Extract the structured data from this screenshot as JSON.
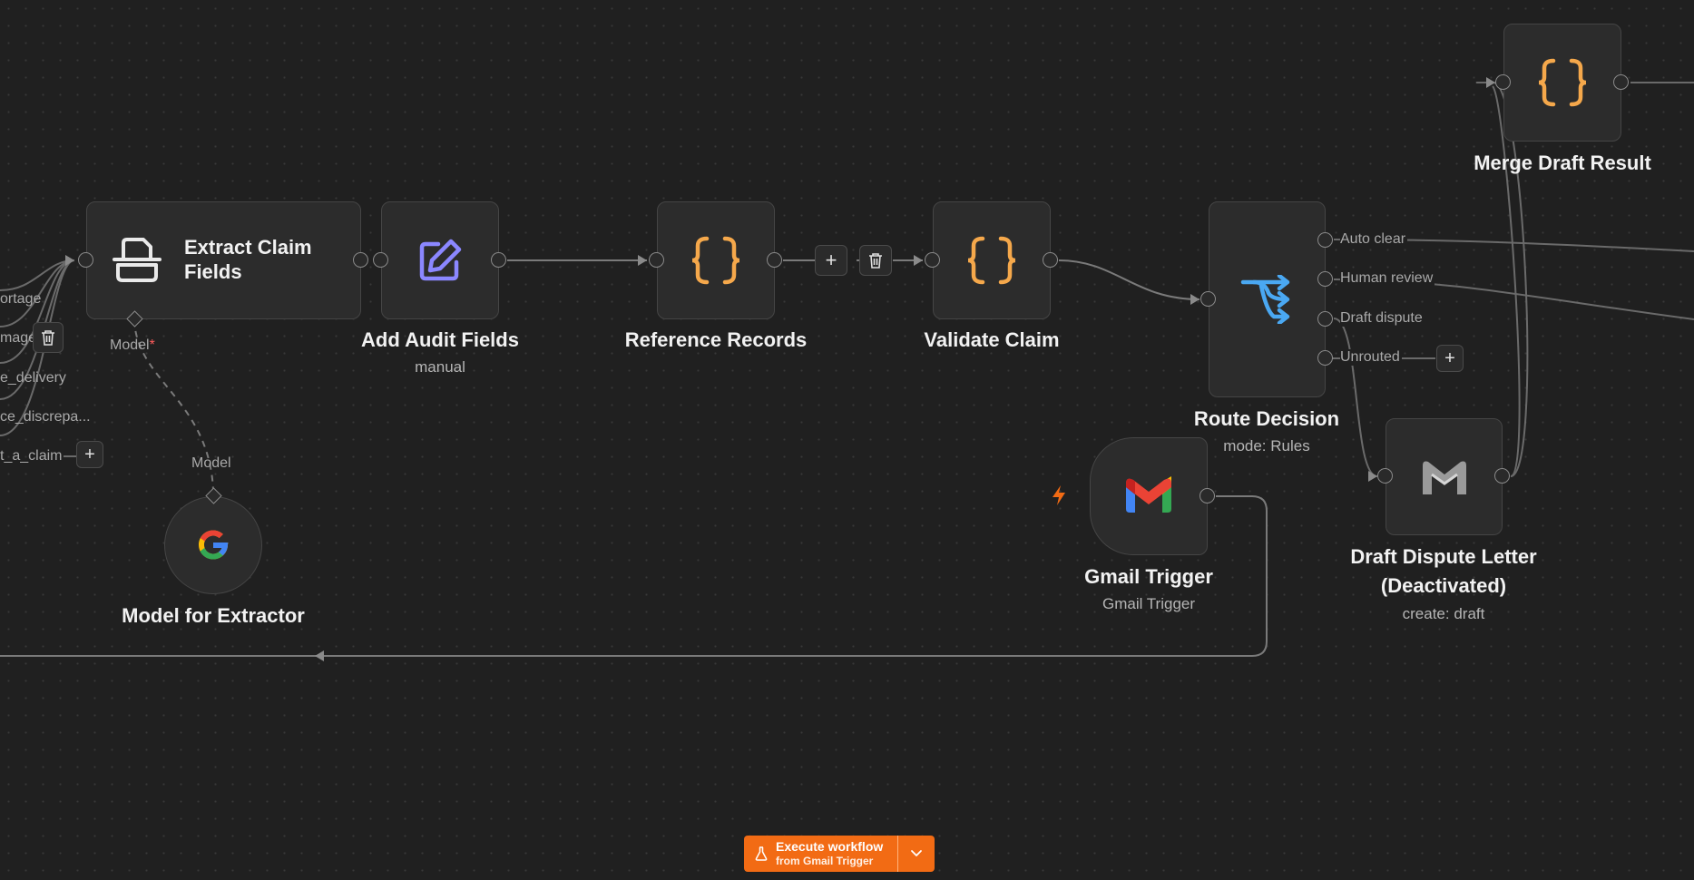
{
  "colors": {
    "canvas_bg": "#202020",
    "node_bg": "#2c2c2c",
    "accent_orange": "#f26b14",
    "code_icon": "#f5a84b",
    "edit_icon": "#8b87ff",
    "router_icon": "#4aa8f2"
  },
  "left_partial_labels": [
    "ortage",
    "mage",
    "e_delivery",
    "ce_discrepa...",
    "t_a_claim"
  ],
  "nodes": {
    "extract_claim": {
      "title": "Extract Claim Fields",
      "icon": "document-scanner-icon",
      "port_label": "Model"
    },
    "add_audit": {
      "title": "Add Audit Fields",
      "subtitle": "manual",
      "icon": "edit-icon"
    },
    "reference_records": {
      "title": "Reference Records",
      "icon": "code-braces-icon"
    },
    "validate_claim": {
      "title": "Validate Claim",
      "icon": "code-braces-icon"
    },
    "route_decision": {
      "title": "Route Decision",
      "subtitle": "mode: Rules",
      "icon": "router-icon",
      "outputs": [
        "Auto clear",
        "Human review",
        "Draft dispute",
        "Unrouted"
      ]
    },
    "merge_draft": {
      "title": "Merge Draft Result",
      "icon": "code-braces-icon"
    },
    "draft_dispute": {
      "title_line1": "Draft Dispute Letter",
      "title_line2": "(Deactivated)",
      "subtitle": "create: draft",
      "icon": "gmail-icon"
    },
    "gmail_trigger": {
      "title": "Gmail Trigger",
      "subtitle": "Gmail Trigger",
      "icon": "gmail-icon"
    },
    "model_extractor": {
      "title": "Model for Extractor",
      "port_label": "Model",
      "icon": "google-icon"
    }
  },
  "execute_button": {
    "line1": "Execute workflow",
    "line2": "from Gmail Trigger"
  }
}
